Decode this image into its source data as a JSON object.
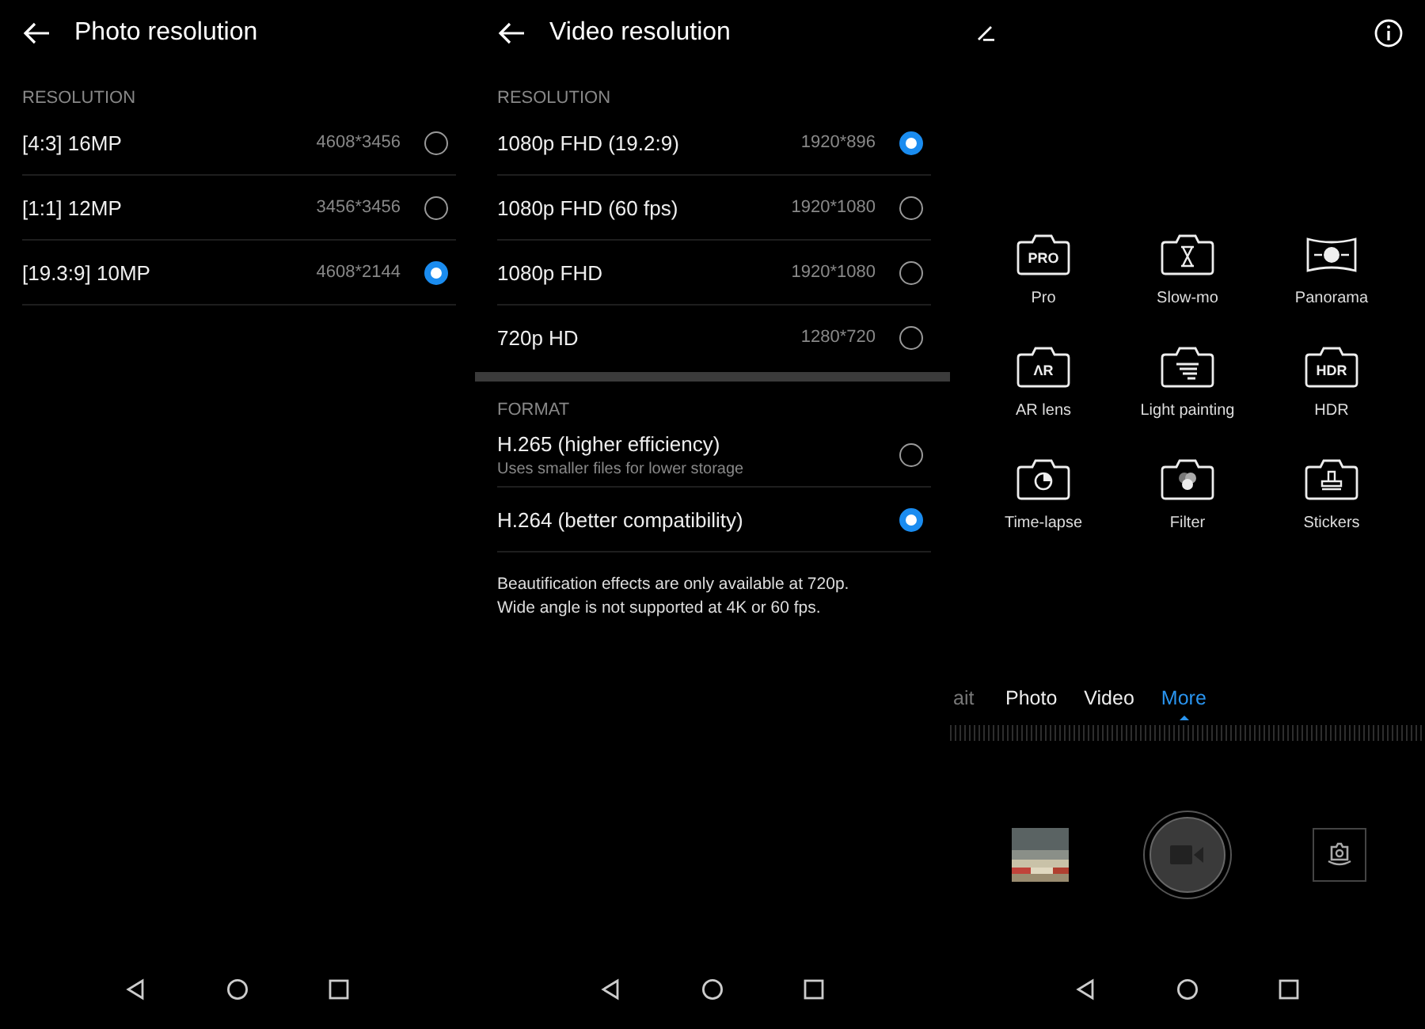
{
  "photo_screen": {
    "title": "Photo resolution",
    "section": "RESOLUTION",
    "options": [
      {
        "label": "[4:3] 16MP",
        "size": "4608*3456",
        "selected": false
      },
      {
        "label": "[1:1] 12MP",
        "size": "3456*3456",
        "selected": false
      },
      {
        "label": "[19.3:9] 10MP",
        "size": "4608*2144",
        "selected": true
      }
    ]
  },
  "video_screen": {
    "title": "Video resolution",
    "section": "RESOLUTION",
    "options": [
      {
        "label": "1080p FHD (19.2:9)",
        "size": "1920*896",
        "selected": true
      },
      {
        "label": "1080p FHD (60 fps)",
        "size": "1920*1080",
        "selected": false
      },
      {
        "label": "1080p FHD",
        "size": "1920*1080",
        "selected": false
      },
      {
        "label": "720p HD",
        "size": "1280*720",
        "selected": false
      }
    ],
    "format_section": "FORMAT",
    "formats": [
      {
        "label": "H.265 (higher efficiency)",
        "hint": "Uses smaller files for lower storage",
        "selected": false
      },
      {
        "label": "H.264 (better compatibility)",
        "selected": true
      }
    ],
    "notes": [
      "Beautification effects are only available at 720p.",
      "Wide angle is not supported at 4K or 60 fps."
    ]
  },
  "camera_screen": {
    "modes": [
      {
        "kind": "text",
        "badge": "PRO",
        "label": "Pro"
      },
      {
        "kind": "slowmo",
        "label": "Slow-mo"
      },
      {
        "kind": "panorama",
        "label": "Panorama"
      },
      {
        "kind": "text",
        "badge": "ΛR",
        "label": "AR lens"
      },
      {
        "kind": "light",
        "label": "Light painting"
      },
      {
        "kind": "text",
        "badge": "HDR",
        "label": "HDR"
      },
      {
        "kind": "timelapse",
        "label": "Time-lapse"
      },
      {
        "kind": "filter",
        "label": "Filter"
      },
      {
        "kind": "stickers",
        "label": "Stickers"
      }
    ],
    "mode_tabs": [
      {
        "label": "ait",
        "selected": false
      },
      {
        "label": "Photo",
        "selected": false
      },
      {
        "label": "Video",
        "selected": false
      },
      {
        "label": "More",
        "selected": true
      }
    ]
  }
}
